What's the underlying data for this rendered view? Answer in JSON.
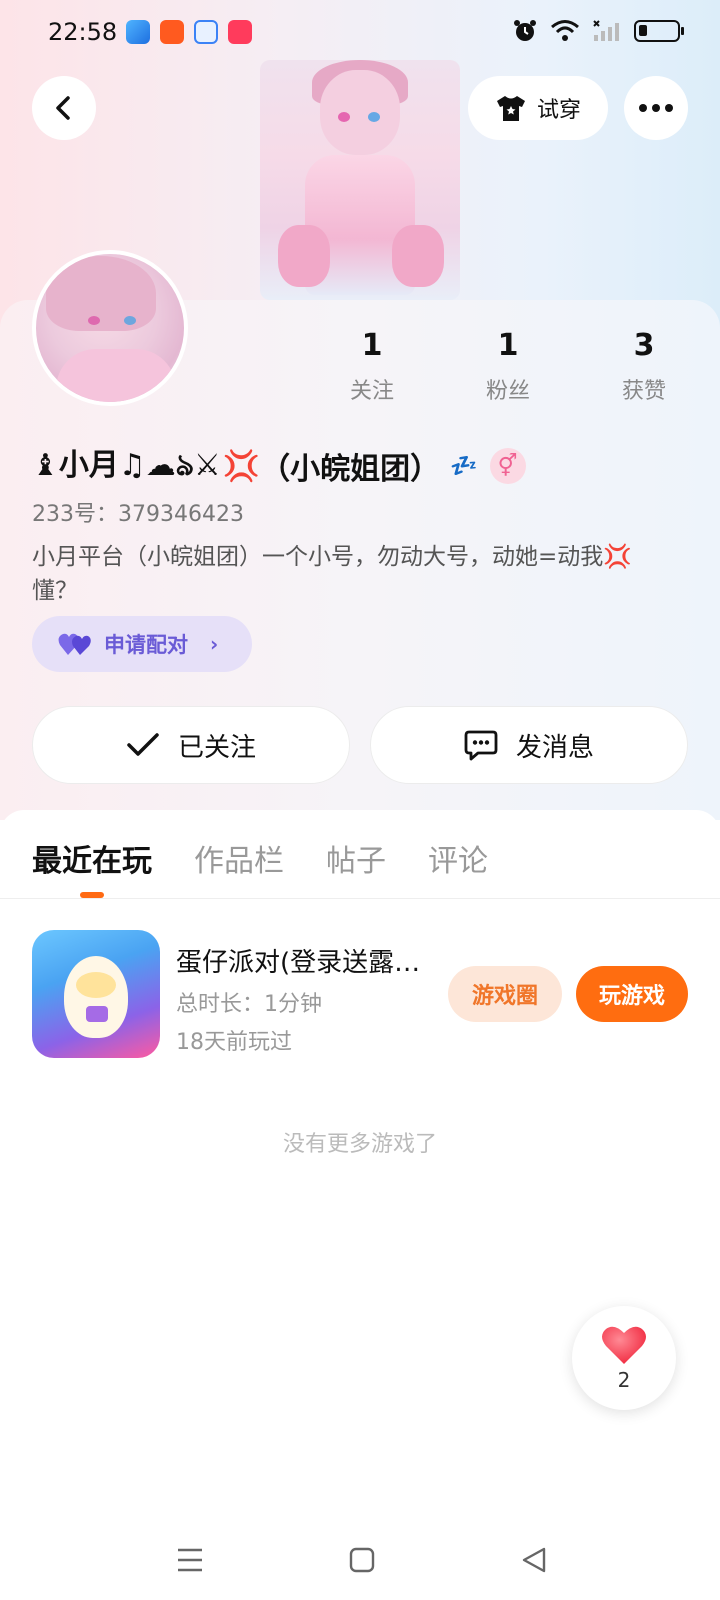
{
  "status_bar": {
    "time": "22:58",
    "app_icons": [
      "blue-app-icon",
      "orange-app-icon",
      "search-app-icon",
      "video-app-icon"
    ],
    "right_icons": [
      "alarm-icon",
      "wifi-icon",
      "signal-icon",
      "battery-icon"
    ]
  },
  "header": {
    "back_icon": "chevron-left-icon",
    "tryon_label": "试穿",
    "tryon_icon": "shirt-icon",
    "more_icon": "more-dots-icon"
  },
  "profile": {
    "username_prefix": "♝小月♫☁ঌ⚔",
    "username_anger": "💢",
    "username_suffix": "（小皖姐团）",
    "zzz": "💤",
    "gender": "⚥",
    "uid_label": "233号：",
    "uid_value": "379346423",
    "bio": "小月平台（小皖姐团）一个小号，勿动大号，动她=动我💢懂？",
    "pair_label": "申请配对"
  },
  "stats": [
    {
      "value": "1",
      "label": "关注"
    },
    {
      "value": "1",
      "label": "粉丝"
    },
    {
      "value": "3",
      "label": "获赞"
    }
  ],
  "actions": {
    "followed_label": "已关注",
    "message_label": "发消息"
  },
  "tabs": [
    {
      "label": "最近在玩",
      "active": true
    },
    {
      "label": "作品栏",
      "active": false
    },
    {
      "label": "帖子",
      "active": false
    },
    {
      "label": "评论",
      "active": false
    }
  ],
  "games": [
    {
      "title": "蛋仔派对(登录送露…",
      "duration_label": "总时长：1分钟",
      "last_played": "18天前玩过",
      "circle_label": "游戏圈",
      "play_label": "玩游戏"
    }
  ],
  "no_more": "没有更多游戏了",
  "like": {
    "count": "2"
  },
  "colors": {
    "accent_orange": "#ff6d10",
    "pair_purple": "#6a5bd6",
    "like_red": "#ff3b4e"
  }
}
